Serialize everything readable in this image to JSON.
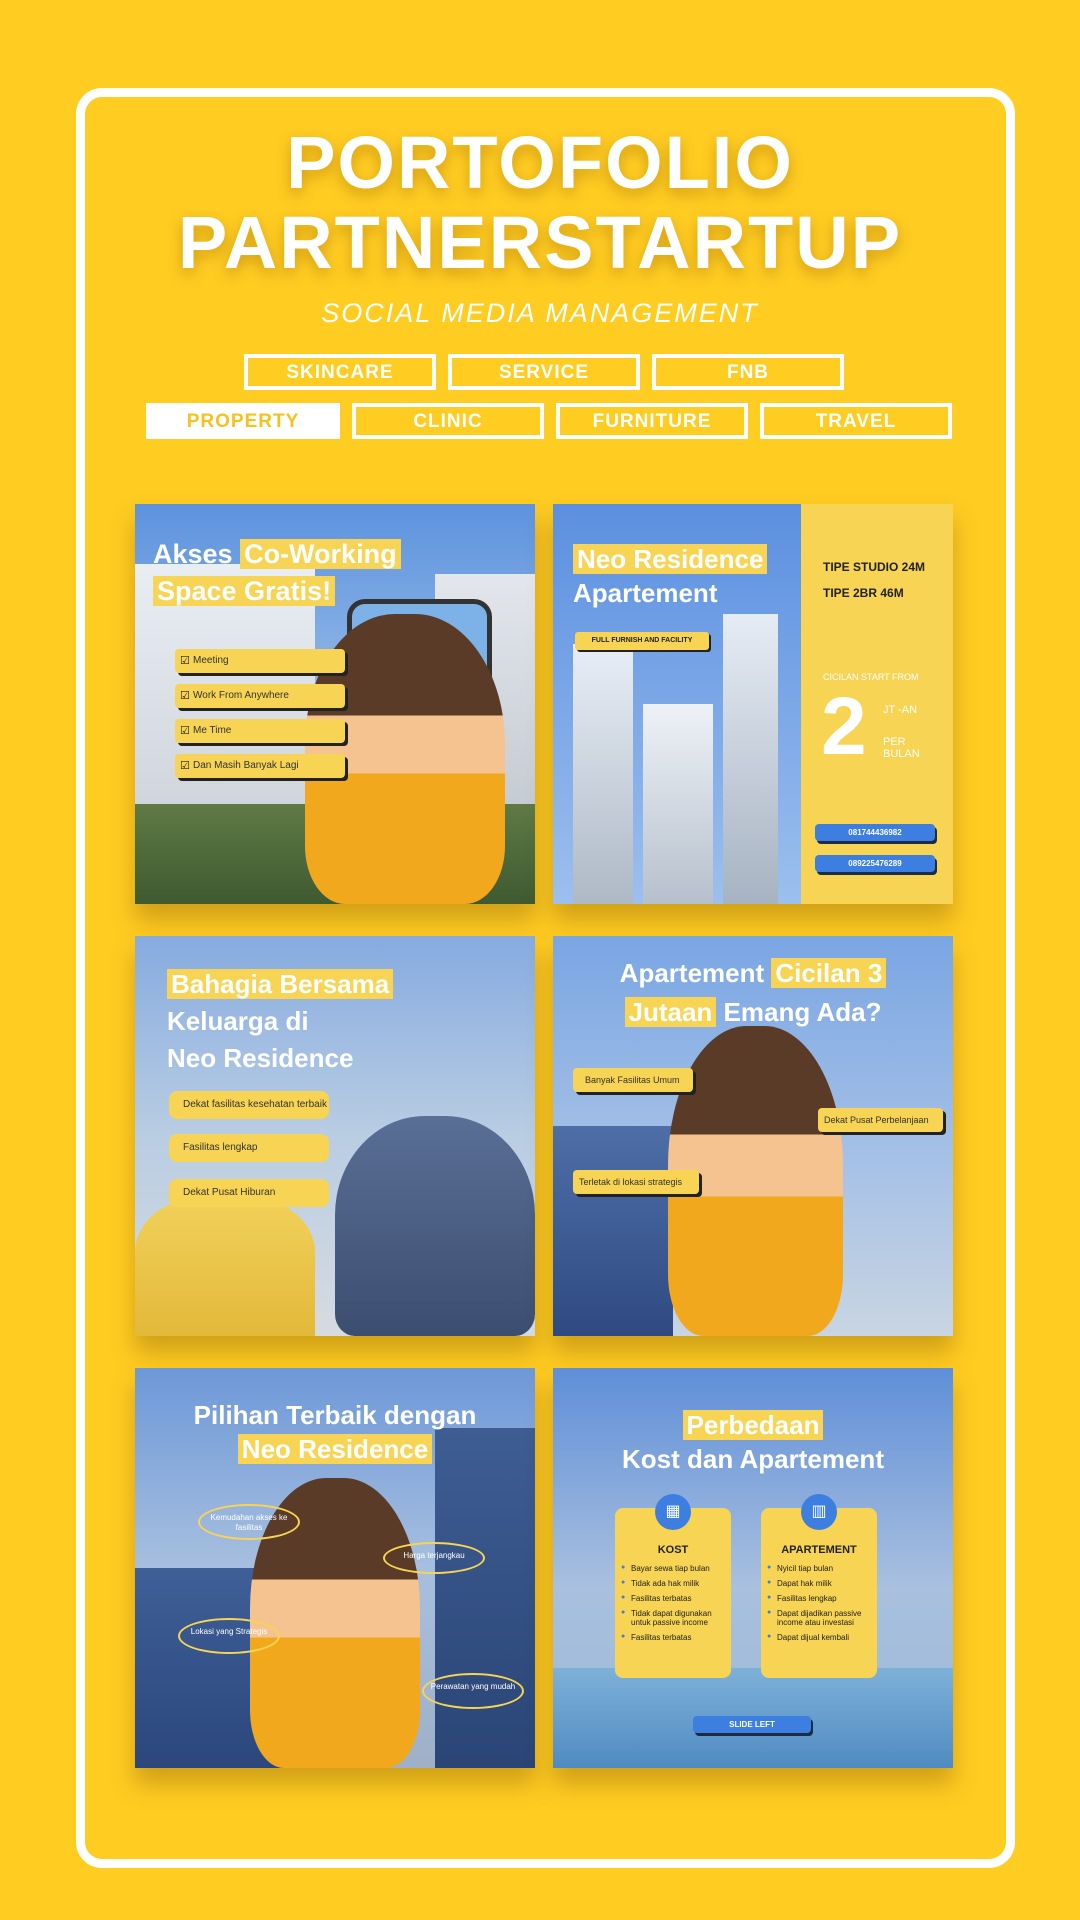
{
  "header": {
    "title_line1": "PORTOFOLIO",
    "title_line2": "PARTNERSTARTUP",
    "subtitle": "SOCIAL MEDIA MANAGEMENT"
  },
  "categories": [
    {
      "label": "SKINCARE",
      "active": false
    },
    {
      "label": "SERVICE",
      "active": false
    },
    {
      "label": "FNB",
      "active": false
    },
    {
      "label": "PROPERTY",
      "active": true
    },
    {
      "label": "CLINIC",
      "active": false
    },
    {
      "label": "FURNITURE",
      "active": false
    },
    {
      "label": "TRAVEL",
      "active": false
    }
  ],
  "colors": {
    "background": "#FFCC22",
    "accent_yellow": "#F7D453",
    "accent_blue": "#3d7fe0"
  },
  "posts": {
    "coworking": {
      "title_a": "Akses ",
      "title_hl1": "Co-Working",
      "title_hl2": "Space Gratis!",
      "items": [
        "Meeting",
        "Work From Anywhere",
        "Me Time",
        "Dan Masih Banyak Lagi"
      ]
    },
    "neo_apartement": {
      "title_hl": "Neo Residence",
      "title_b": "Apartement",
      "badge": "FULL FURNISH AND FACILITY",
      "types": [
        "TIPE STUDIO 24M",
        "TIPE 2BR 46M"
      ],
      "cicilan_label": "CICILAN START FROM",
      "cicilan_value": "2",
      "cicilan_unit": "JT -AN",
      "cicilan_per": "PER BULAN",
      "phones": [
        "081744436982",
        "089225476289"
      ]
    },
    "bahagia": {
      "title_hl": "Bahagia Bersama",
      "title_b": "Keluarga di",
      "title_c": "Neo Residence",
      "items": [
        "Dekat fasilitas kesehatan terbaik",
        "Fasilitas lengkap",
        "Dekat Pusat Hiburan"
      ]
    },
    "cicilan": {
      "title_a": "Apartement ",
      "title_hl1": "Cicilan 3",
      "title_hl2": "Jutaan",
      "title_b": " Emang Ada?",
      "items": [
        "Banyak Fasilitas Umum",
        "Dekat Pusat Perbelanjaan",
        "Terletak di lokasi strategis"
      ]
    },
    "pilihan": {
      "title_a": "Pilihan Terbaik dengan",
      "title_hl": "Neo Residence",
      "ovals": [
        "Kemudahan akses ke fasilitas",
        "Harga terjangkau",
        "Lokasi yang Strategis",
        "Perawatan yang mudah"
      ]
    },
    "perbedaan": {
      "title_hl": "Perbedaan",
      "title_b": "Kost dan Apartement",
      "kost_title": "KOST",
      "kost_items": [
        "Bayar sewa tiap bulan",
        "Tidak ada hak milik",
        "Fasilitas terbatas",
        "Tidak dapat digunakan untuk passive income",
        "Fasilitas terbatas"
      ],
      "apt_title": "APARTEMENT",
      "apt_items": [
        "Nyicil tiap bulan",
        "Dapat hak milik",
        "Fasilitas lengkap",
        "Dapat dijadikan passive income atau investasi",
        "Dapat dijual kembali"
      ],
      "slide_label": "SLIDE LEFT"
    }
  }
}
